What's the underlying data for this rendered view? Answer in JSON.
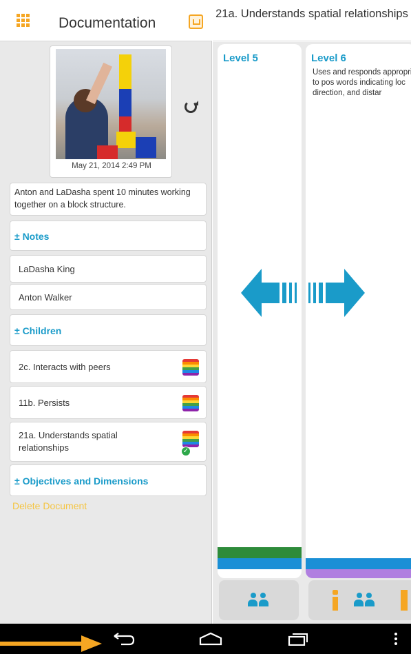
{
  "left_panel": {
    "title": "Documentation",
    "photo_timestamp": "May  21, 2014 2:49 PM",
    "description": "Anton and LaDasha spent 10 minutes working together on a block structure.",
    "notes_header": "± Notes",
    "notes": [
      "LaDasha King",
      "Anton Walker"
    ],
    "children_header": "± Children",
    "children": [
      {
        "label": "2c. Interacts with peers",
        "checked": false
      },
      {
        "label": "11b. Persists",
        "checked": false
      },
      {
        "label": "21a. Understands spatial relationships",
        "checked": true
      }
    ],
    "objectives_header": "± Objectives and Dimensions",
    "delete_label": "Delete Document"
  },
  "right_panel": {
    "title": "21a. Understands spatial relationships",
    "levels": [
      {
        "title": "Level 5",
        "description": ""
      },
      {
        "title": "Level 6",
        "description": "Uses and responds appropriately to pos words indicating loc direction, and distar"
      }
    ]
  },
  "colors": {
    "accent_blue": "#1a9bc9",
    "accent_orange": "#f5a623",
    "delete_yellow": "#f5c542",
    "level5_bars": [
      "#2e8b3a",
      "#1a8fd6"
    ],
    "level6_bars": [
      "#1a8fd6",
      "#b07fe0"
    ],
    "rainbow": [
      "#e53935",
      "#fb8c00",
      "#fdd835",
      "#43a047",
      "#1e88e5",
      "#8e24aa"
    ]
  },
  "icons": {
    "apps": "grid-icon",
    "share": "share-icon",
    "rotate": "rotate-icon",
    "swipe": "double-arrow-icon",
    "people": "people-icon",
    "info": "info-icon",
    "nav": [
      "back-icon",
      "home-icon",
      "recent-apps-icon",
      "menu-icon"
    ]
  }
}
